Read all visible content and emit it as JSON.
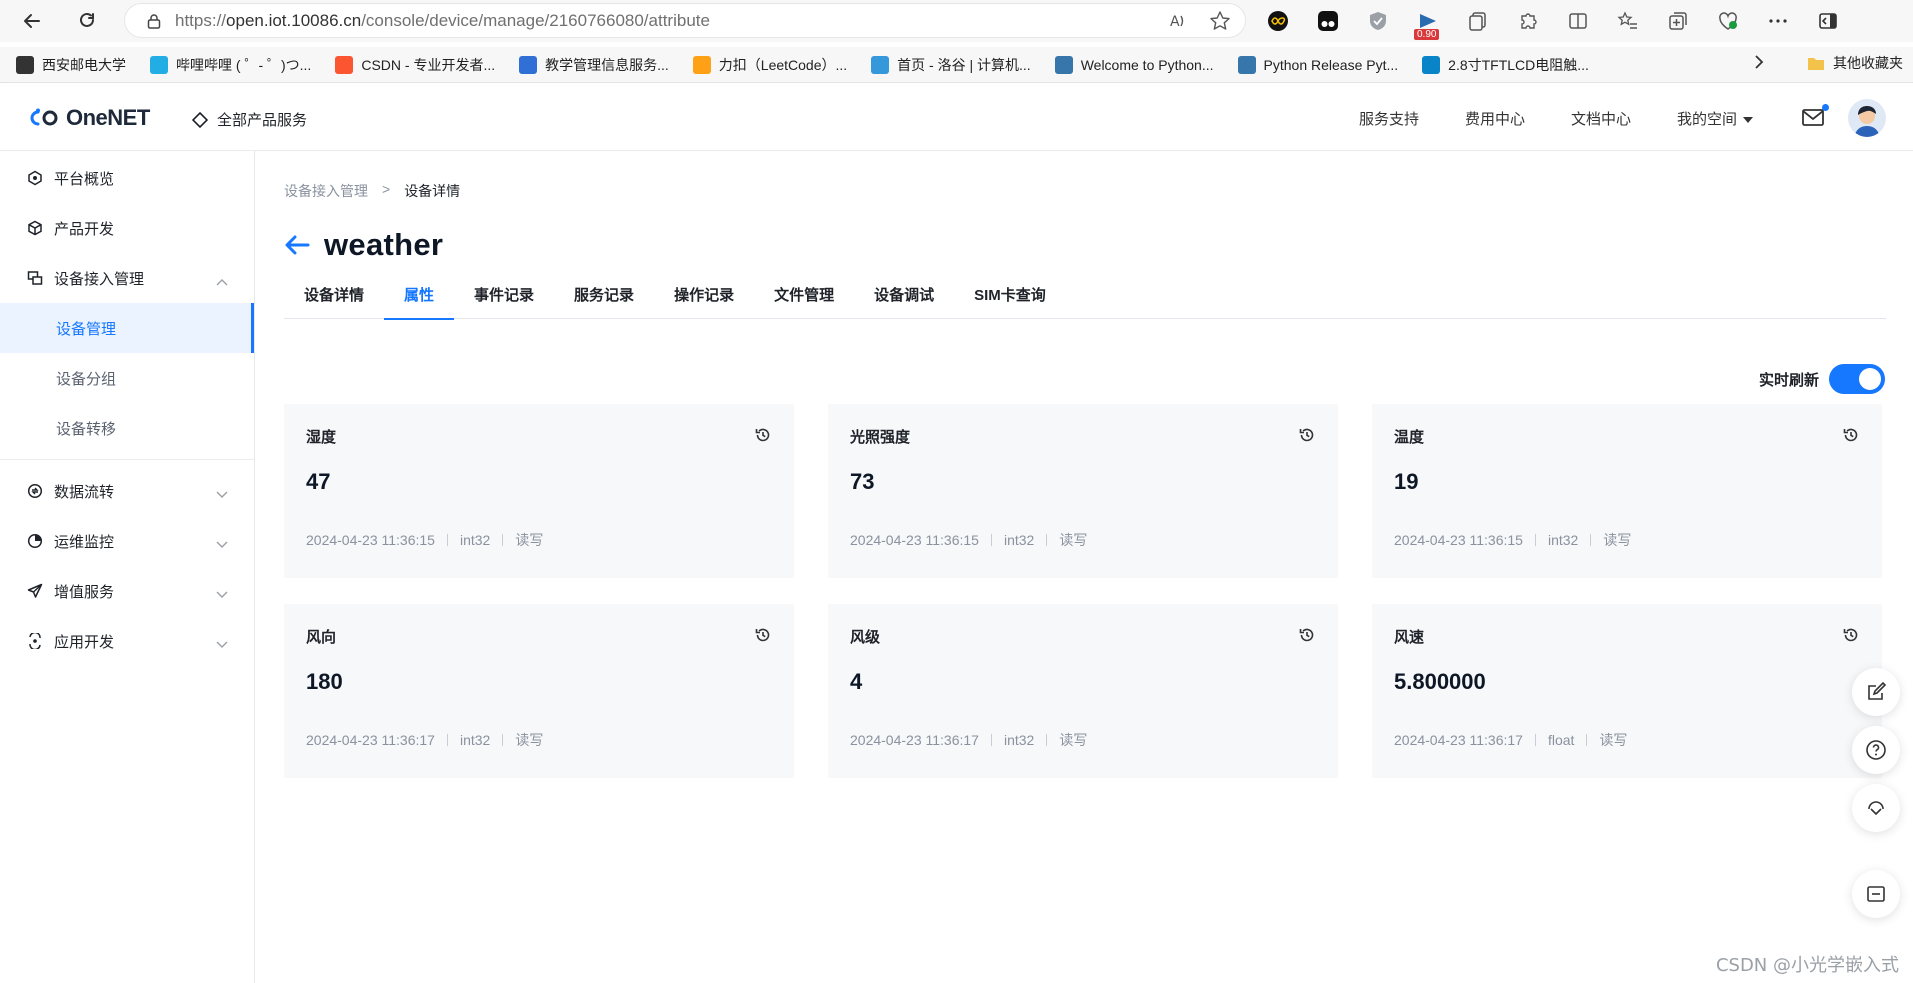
{
  "browser": {
    "url_prefix": "https://",
    "url_domain": "open.iot.10086.cn",
    "url_path": "/console/device/manage/2160766080/attribute",
    "ext_badge": "0.90",
    "bookmarks": [
      {
        "label": "西安邮电大学",
        "icon": "page-icon",
        "color": "#333333"
      },
      {
        "label": "哔哩哔哩 ( ゜- ゜)つ...",
        "icon": "bilibili-icon",
        "color": "#23ade5"
      },
      {
        "label": "CSDN - 专业开发者...",
        "icon": "csdn-icon",
        "color": "#fc5531"
      },
      {
        "label": "教学管理信息服务...",
        "icon": "education-icon",
        "color": "#2f6fd6"
      },
      {
        "label": "力扣（LeetCode）...",
        "icon": "leetcode-icon",
        "color": "#ffa116"
      },
      {
        "label": "首页 - 洛谷 | 计算机...",
        "icon": "luogu-icon",
        "color": "#3498db"
      },
      {
        "label": "Welcome to Python...",
        "icon": "python-icon",
        "color": "#3776ab"
      },
      {
        "label": "Python Release Pyt...",
        "icon": "python-icon",
        "color": "#3776ab"
      },
      {
        "label": "2.8寸TFTLCD电阻触...",
        "icon": "site-icon",
        "color": "#0a84c8"
      }
    ],
    "other_bookmarks": "其他收藏夹"
  },
  "header": {
    "logo_text": "OneNET",
    "all_products": "全部产品服务",
    "links": [
      "服务支持",
      "费用中心",
      "文档中心"
    ],
    "my_space": "我的空间"
  },
  "sidebar": {
    "items": [
      {
        "label": "平台概览",
        "icon": "overview-icon"
      },
      {
        "label": "产品开发",
        "icon": "cube-icon"
      },
      {
        "label": "设备接入管理",
        "icon": "device-icon"
      }
    ],
    "sub_items": [
      "设备管理",
      "设备分组",
      "设备转移"
    ],
    "lower_items": [
      {
        "label": "数据流转",
        "icon": "dataflow-icon"
      },
      {
        "label": "运维监控",
        "icon": "monitor-icon"
      },
      {
        "label": "增值服务",
        "icon": "send-icon"
      },
      {
        "label": "应用开发",
        "icon": "app-icon"
      }
    ]
  },
  "main": {
    "breadcrumb": [
      "设备接入管理",
      "设备详情"
    ],
    "breadcrumb_sep": ">",
    "title": "weather",
    "tabs": [
      "设备详情",
      "属性",
      "事件记录",
      "服务记录",
      "操作记录",
      "文件管理",
      "设备调试",
      "SIM卡查询"
    ],
    "active_tab": "属性",
    "realtime_label": "实时刷新",
    "realtime_on": true,
    "cards": [
      {
        "name": "湿度",
        "value": "47",
        "time": "2024-04-23 11:36:15",
        "type": "int32",
        "access": "读写"
      },
      {
        "name": "光照强度",
        "value": "73",
        "time": "2024-04-23 11:36:15",
        "type": "int32",
        "access": "读写"
      },
      {
        "name": "温度",
        "value": "19",
        "time": "2024-04-23 11:36:15",
        "type": "int32",
        "access": "读写"
      },
      {
        "name": "风向",
        "value": "180",
        "time": "2024-04-23 11:36:17",
        "type": "int32",
        "access": "读写"
      },
      {
        "name": "风级",
        "value": "4",
        "time": "2024-04-23 11:36:17",
        "type": "int32",
        "access": "读写"
      },
      {
        "name": "风速",
        "value": "5.800000",
        "time": "2024-04-23 11:36:17",
        "type": "float",
        "access": "读写"
      }
    ]
  },
  "watermark": "CSDN @小光学嵌入式",
  "colors": {
    "accent": "#1677ff",
    "card_bg": "#f7f8fa"
  }
}
